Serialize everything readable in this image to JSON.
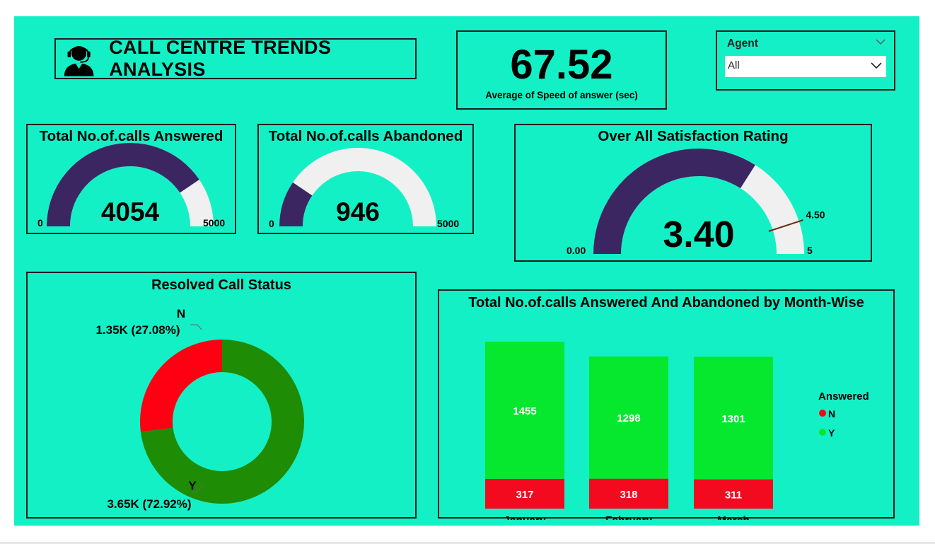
{
  "header": {
    "title": "CALL CENTRE TRENDS ANALYSIS",
    "icon": "headset-agent-icon"
  },
  "kpi": {
    "value": "67.52",
    "label": "Average of Speed of answer (sec)"
  },
  "slicer": {
    "title": "Agent",
    "selected": "All"
  },
  "colors": {
    "background": "#14f0c6",
    "gauge_fill": "#3b2662",
    "gauge_track": "#f0f0f0",
    "target_line": "#6b2b10",
    "resolved_n": "#ff0012",
    "resolved_y": "#1f8c06",
    "answered_n": "#f40a1f",
    "answered_y": "#05e82e"
  },
  "gauges": [
    {
      "title": "Total No.of.calls Answered",
      "value": 4054,
      "value_label": "4054",
      "min": 0,
      "max": 5000,
      "min_label": "0",
      "max_label": "5000"
    },
    {
      "title": "Total No.of.calls Abandoned",
      "value": 946,
      "value_label": "946",
      "min": 0,
      "max": 5000,
      "min_label": "0",
      "max_label": "5000"
    },
    {
      "title": "Over All Satisfaction Rating",
      "value": 3.4,
      "value_label": "3.40",
      "min": 0,
      "max": 5,
      "min_label": "0.00",
      "max_label": "5",
      "target": 4.5,
      "target_label": "4.50"
    }
  ],
  "chart_data": [
    {
      "type": "pie",
      "title": "Resolved Call Status",
      "categories": [
        "N",
        "Y"
      ],
      "values": [
        1350,
        3650
      ],
      "data_labels": [
        "1.35K (27.08%)",
        "3.65K (72.92%)"
      ],
      "percentages": [
        27.08,
        72.92
      ]
    },
    {
      "type": "bar",
      "stacked": true,
      "title": "Total No.of.calls Answered And Abandoned by Month-Wise",
      "categories": [
        "January",
        "February",
        "March"
      ],
      "legend_title": "Answered",
      "legend_position": "right",
      "series": [
        {
          "name": "N",
          "values": [
            317,
            318,
            311
          ]
        },
        {
          "name": "Y",
          "values": [
            1455,
            1298,
            1301
          ]
        }
      ]
    }
  ]
}
